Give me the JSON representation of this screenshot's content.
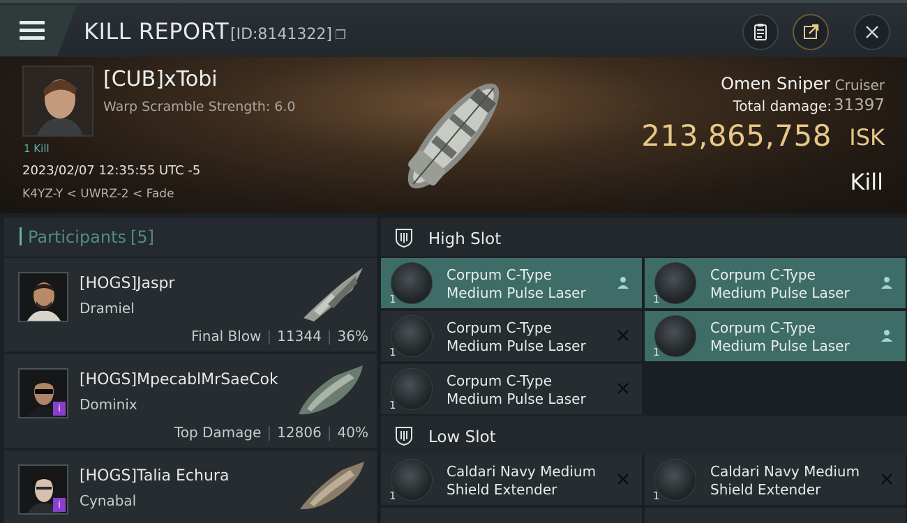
{
  "header": {
    "title": "KILL REPORT",
    "id_label": "[ID:8141322]"
  },
  "victim": {
    "name": "[CUB]xTobi",
    "warp_line": "Warp Scramble Strength: 6.0",
    "kill_count": "1 Kill",
    "datetime": "2023/02/07 12:35:55 UTC -5",
    "location": "K4YZ-Y < UWRZ-2 < Fade"
  },
  "ship": {
    "name": "Omen Sniper",
    "class": "Cruiser",
    "damage_label": "Total damage:",
    "damage_value": "31397",
    "isk_value": "213,865,758",
    "isk_unit": "ISK",
    "result": "Kill"
  },
  "participants": {
    "title": "Participants",
    "count": "[5]",
    "items": [
      {
        "name": "[HOGS]Jaspr",
        "ship": "Dramiel",
        "role": "Final Blow",
        "damage": "11344",
        "percent": "36%",
        "badge": false
      },
      {
        "name": "[HOGS]MpecablMrSaeCok",
        "ship": "Dominix",
        "role": "Top Damage",
        "damage": "12806",
        "percent": "40%",
        "badge": true
      },
      {
        "name": "[HOGS]Talia Echura",
        "ship": "Cynabal",
        "role": "",
        "damage": "",
        "percent": "",
        "badge": true
      }
    ]
  },
  "fittings": {
    "high_slot": {
      "title": "High Slot",
      "modules": [
        {
          "line1": "Corpum C-Type",
          "line2": "Medium Pulse Laser",
          "qty": "1",
          "status": "person-icon",
          "state": "fitted"
        },
        {
          "line1": "Corpum C-Type",
          "line2": "Medium Pulse Laser",
          "qty": "1",
          "status": "person-icon",
          "state": "fitted"
        },
        {
          "line1": "Corpum C-Type",
          "line2": "Medium Pulse Laser",
          "qty": "1",
          "status": "cross-icon",
          "state": "destroyed"
        },
        {
          "line1": "Corpum C-Type",
          "line2": "Medium Pulse Laser",
          "qty": "1",
          "status": "person-icon",
          "state": "fitted"
        },
        {
          "line1": "Corpum C-Type",
          "line2": "Medium Pulse Laser",
          "qty": "1",
          "status": "cross-icon",
          "state": "destroyed"
        }
      ]
    },
    "low_slot": {
      "title": "Low Slot",
      "modules": [
        {
          "line1": "Caldari Navy Medium",
          "line2": "Shield Extender",
          "qty": "1",
          "status": "cross-icon",
          "state": "destroyed"
        },
        {
          "line1": "Caldari Navy Medium",
          "line2": "Shield Extender",
          "qty": "1",
          "status": "cross-icon",
          "state": "destroyed"
        }
      ]
    }
  },
  "colors": {
    "accent_teal": "#3d6d66",
    "isk_gold": "#e8c887",
    "badge_purple": "#8a3fd0"
  }
}
